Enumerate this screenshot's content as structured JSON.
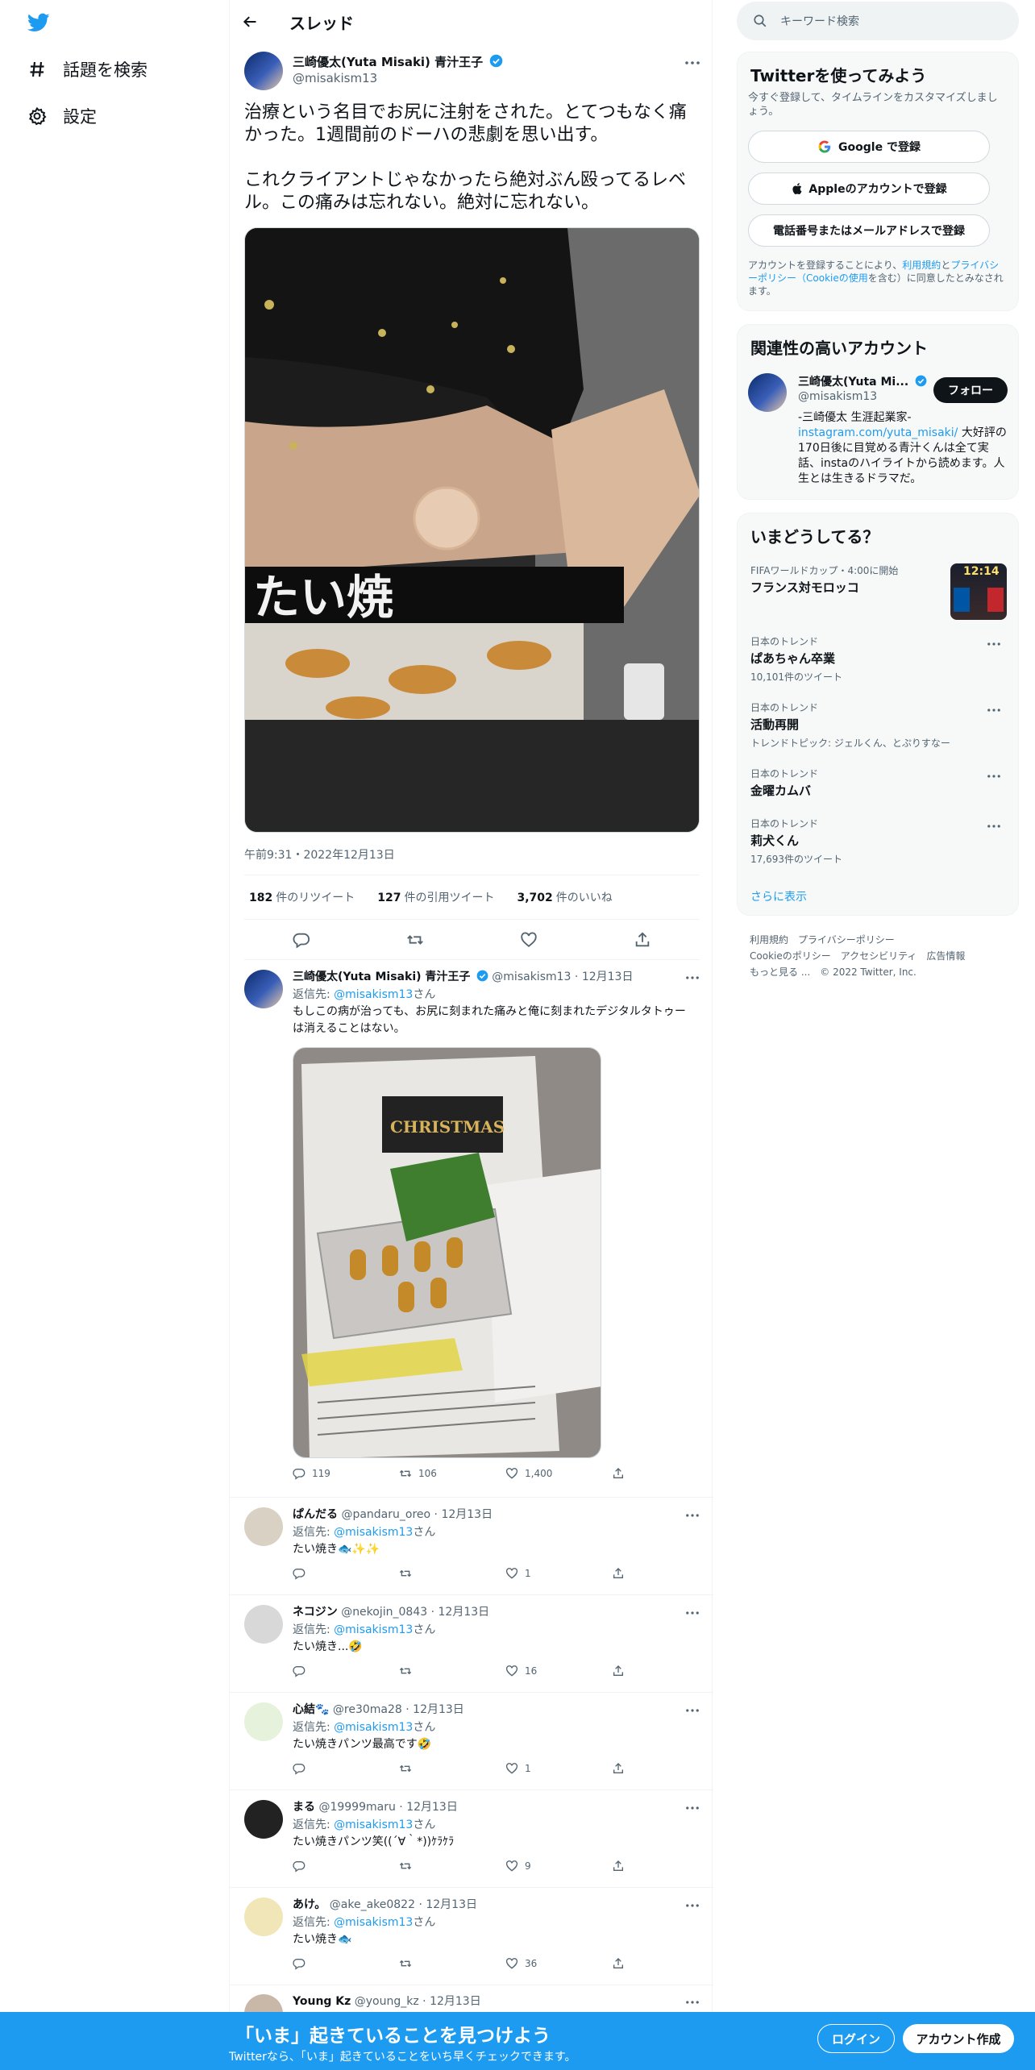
{
  "nav": {
    "items": [
      {
        "label": "話題を検索",
        "icon": "hashtag-icon"
      },
      {
        "label": "設定",
        "icon": "gear-icon"
      }
    ]
  },
  "header": {
    "title": "スレッド"
  },
  "focal_tweet": {
    "name": "三崎優太(Yuta Misaki) 青汁王子",
    "handle": "@misakism13",
    "text": "治療という名目でお尻に注射をされた。とてつもなく痛かった。1週間前のドーハの悲劇を思い出す。\n\nこれクライアントじゃなかったら絶対ぶん殴ってるレベル。この痛みは忘れない。絶対に忘れない。",
    "timestamp": "午前9:31・2022年12月13日",
    "retweets": "182",
    "retweets_label": "件のリツイート",
    "quotes": "127",
    "quotes_label": "件の引用ツイート",
    "likes": "3,702",
    "likes_label": "件のいいね"
  },
  "replies": [
    {
      "name": "三崎優太(Yuta Misaki) 青汁王子",
      "handle": "@misakism13",
      "date": "12月13日",
      "replyto_prefix": "返信先: ",
      "replyto": "@misakism13",
      "replyto_suffix": "さん",
      "text": "もしこの病が治っても、お尻に刻まれた痛みと俺に刻まれたデジタルタトゥーは消えることはない。",
      "replies": "119",
      "retweets": "106",
      "likes": "1,400"
    },
    {
      "name": "ぱんだる",
      "handle": "@pandaru_oreo",
      "date": "12月13日",
      "replyto_prefix": "返信先: ",
      "replyto": "@misakism13",
      "replyto_suffix": "さん",
      "text": "たい焼き🐟✨✨",
      "replies": "",
      "retweets": "",
      "likes": "1"
    },
    {
      "name": "ネコジン",
      "handle": "@nekojin_0843",
      "date": "12月13日",
      "replyto_prefix": "返信先: ",
      "replyto": "@misakism13",
      "replyto_suffix": "さん",
      "text": "たい焼き...🤣",
      "replies": "",
      "retweets": "",
      "likes": "16"
    },
    {
      "name": "心結🐾",
      "handle": "@re30ma28",
      "date": "12月13日",
      "replyto_prefix": "返信先: ",
      "replyto": "@misakism13",
      "replyto_suffix": "さん",
      "text": "たい焼きパンツ最高です🤣",
      "replies": "",
      "retweets": "",
      "likes": "1"
    },
    {
      "name": "まる",
      "handle": "@19999maru",
      "date": "12月13日",
      "replyto_prefix": "返信先: ",
      "replyto": "@misakism13",
      "replyto_suffix": "さん",
      "text": "たい焼きパンツ笑((´∀｀*))ｹﾗｹﾗ",
      "replies": "",
      "retweets": "",
      "likes": "9"
    },
    {
      "name": "あけ。",
      "handle": "@ake_ake0822",
      "date": "12月13日",
      "replyto_prefix": "返信先: ",
      "replyto": "@misakism13",
      "replyto_suffix": "さん",
      "text": "たい焼き🐟",
      "replies": "",
      "retweets": "",
      "likes": "36"
    },
    {
      "name": "Young Kz",
      "handle": "@young_kz",
      "date": "12月13日"
    }
  ],
  "search": {
    "placeholder": "キーワード検索"
  },
  "signup": {
    "title": "Twitterを使ってみよう",
    "subtitle": "今すぐ登録して、タイムラインをカスタマイズしましょう。",
    "google": "Google で登録",
    "apple": "Appleのアカウントで登録",
    "phone": "電話番号またはメールアドレスで登録",
    "terms_1": "アカウントを登録することにより、",
    "terms_link1": "利用規約",
    "terms_2": "と",
    "terms_link2": "プライバシーポリシー（Cookieの使用",
    "terms_3": "を含む）に同意したとみなされます。"
  },
  "related": {
    "title": "関連性の高いアカウント",
    "name": "三崎優太(Yuta Mi...",
    "handle": "@misakism13",
    "follow": "フォロー",
    "bio_1": "-三崎優太 生涯起業家-",
    "bio_link": "instagram.com/yuta_misaki/",
    "bio_2": " 大好評の170日後に目覚める青汁くんは全て実話、instaのハイライトから読めます。人生とは生きるドラマだ。"
  },
  "trends": {
    "title": "いまどうしてる？",
    "items": [
      {
        "cat": "FIFAワールドカップ・4:00に開始",
        "title": "フランス対モロッコ",
        "count": ""
      },
      {
        "cat": "日本のトレンド",
        "title": "ぱあちゃん卒業",
        "count": "10,101件のツイート"
      },
      {
        "cat": "日本のトレンド",
        "title": "活動再開",
        "count": "トレンドトピック: ジェルくん、とぷりすなー"
      },
      {
        "cat": "日本のトレンド",
        "title": "金曜カムバ",
        "count": ""
      },
      {
        "cat": "日本のトレンド",
        "title": "莉犬くん",
        "count": "17,693件のツイート"
      }
    ],
    "more": "さらに表示",
    "score": "12:14"
  },
  "footer": {
    "line1": "利用規約　プライバシーポリシー",
    "line2": "Cookieのポリシー　アクセシビリティ　広告情報",
    "line3": "もっと見る ...　© 2022 Twitter, Inc."
  },
  "bottombar": {
    "headline": "「いま」起きていることを見つけよう",
    "sub": "Twitterなら、「いま」起きていることをいち早くチェックできます。",
    "login": "ログイン",
    "create": "アカウント作成"
  },
  "colors": {
    "accent": "#1d9bf0",
    "text": "#0f1419",
    "secondary": "#536471"
  }
}
